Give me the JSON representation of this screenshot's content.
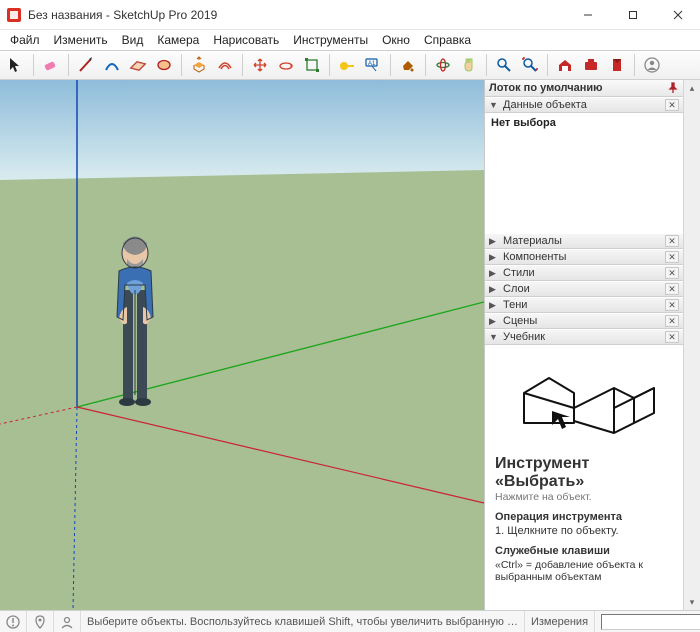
{
  "title": "Без названия - SketchUp Pro 2019",
  "menu": [
    "Файл",
    "Изменить",
    "Вид",
    "Камера",
    "Нарисовать",
    "Инструменты",
    "Окно",
    "Справка"
  ],
  "tray": {
    "title": "Лоток по умолчанию",
    "panels": {
      "entity": {
        "label": "Данные объекта",
        "expanded": true,
        "body": "Нет выбора"
      },
      "materials": {
        "label": "Материалы"
      },
      "components": {
        "label": "Компоненты"
      },
      "styles": {
        "label": "Стили"
      },
      "layers": {
        "label": "Слои"
      },
      "shadows": {
        "label": "Тени"
      },
      "scenes": {
        "label": "Сцены"
      },
      "instructor": {
        "label": "Учебник",
        "expanded": true
      }
    }
  },
  "instructor": {
    "title1": "Инструмент",
    "title2": "«Выбрать»",
    "subtitle": "Нажмите на объект.",
    "op_heading": "Операция инструмента",
    "op_item": "1. Щелкните по объекту.",
    "keys_heading": "Служебные клавиши",
    "keys_item": "«Ctrl» = добавление объекта к выбранным объектам"
  },
  "status": {
    "hint": "Выберите объекты. Воспользуйтесь клавишей Shift, чтобы увеличить выбранную …",
    "meas_label": "Измерения"
  }
}
